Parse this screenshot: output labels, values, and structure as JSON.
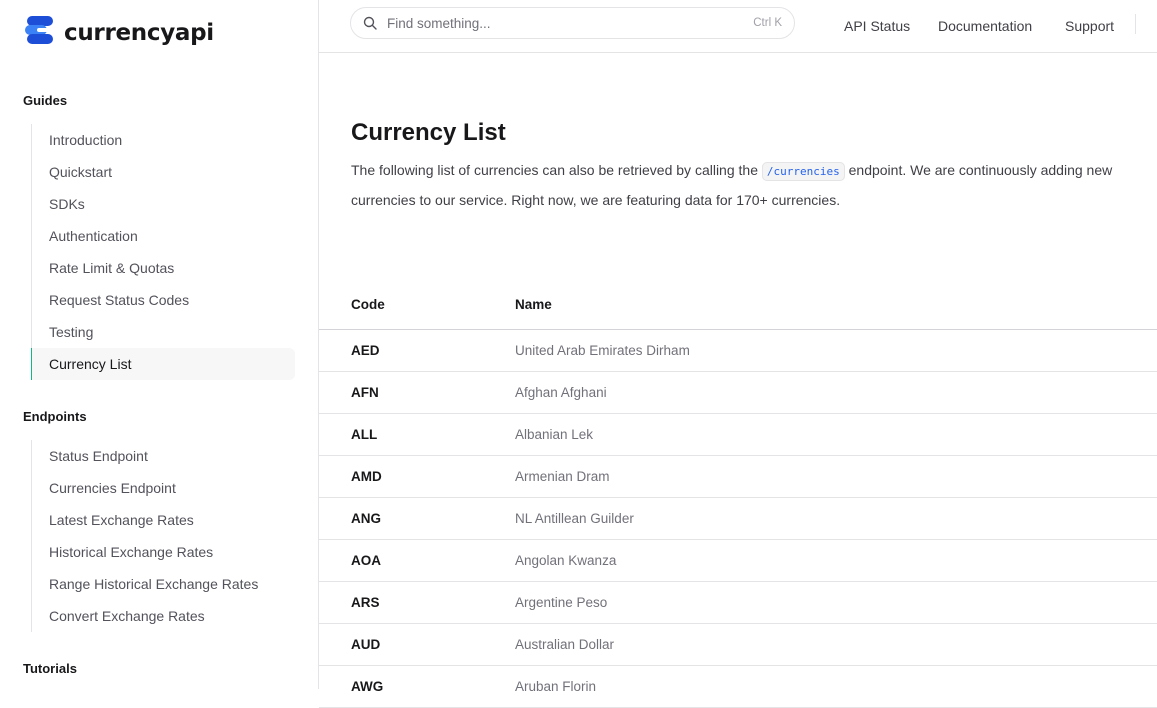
{
  "brand": {
    "name": "currencyapi"
  },
  "search": {
    "placeholder": "Find something...",
    "shortcut": "Ctrl K"
  },
  "topnav": {
    "api_status": "API Status",
    "documentation": "Documentation",
    "support": "Support"
  },
  "sidebar": {
    "sections": [
      {
        "heading": "Guides",
        "items": [
          "Introduction",
          "Quickstart",
          "SDKs",
          "Authentication",
          "Rate Limit & Quotas",
          "Request Status Codes",
          "Testing",
          "Currency List"
        ]
      },
      {
        "heading": "Endpoints",
        "items": [
          "Status Endpoint",
          "Currencies Endpoint",
          "Latest Exchange Rates",
          "Historical Exchange Rates",
          "Range Historical Exchange Rates",
          "Convert Exchange Rates"
        ]
      },
      {
        "heading": "Tutorials",
        "items": []
      }
    ],
    "active_item": "Currency List"
  },
  "page": {
    "title": "Currency List",
    "intro_before": "The following list of currencies can also be retrieved by calling the ",
    "intro_code": "/currencies",
    "intro_after": " endpoint. We are continuously adding new currencies to our service. Right now, we are featuring data for 170+ currencies."
  },
  "table": {
    "headers": {
      "code": "Code",
      "name": "Name"
    },
    "rows": [
      [
        "AED",
        "United Arab Emirates Dirham"
      ],
      [
        "AFN",
        "Afghan Afghani"
      ],
      [
        "ALL",
        "Albanian Lek"
      ],
      [
        "AMD",
        "Armenian Dram"
      ],
      [
        "ANG",
        "NL Antillean Guilder"
      ],
      [
        "AOA",
        "Angolan Kwanza"
      ],
      [
        "ARS",
        "Argentine Peso"
      ],
      [
        "AUD",
        "Australian Dollar"
      ],
      [
        "AWG",
        "Aruban Florin"
      ]
    ]
  },
  "colors": {
    "accent": "#10b981",
    "brand": "#2563eb",
    "code_text": "#2563eb"
  }
}
